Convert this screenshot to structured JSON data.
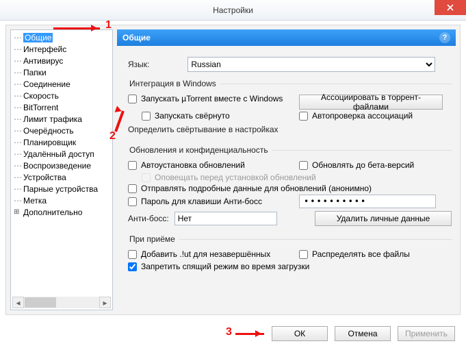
{
  "window": {
    "title": "Настройки"
  },
  "tree": {
    "items": [
      "Общие",
      "Интерфейс",
      "Антивирус",
      "Папки",
      "Соединение",
      "Скорость",
      "BitTorrent",
      "Лимит трафика",
      "Очерёдность",
      "Планировщик",
      "Удалённый доступ",
      "Воспроизведение",
      "Устройства",
      "Парные устройства",
      "Метка",
      "Дополнительно"
    ]
  },
  "panel": {
    "title": "Общие"
  },
  "language": {
    "label": "Язык:",
    "value": "Russian"
  },
  "integration": {
    "legend": "Интеграция в Windows",
    "start_with_windows": "Запускать µTorrent вместе с Windows",
    "assoc_button": "Ассоциировать в торрент-файлами",
    "start_minimized": "Запускать свёрнуто",
    "auto_check_assoc": "Автопроверка ассоциаций",
    "define_minimize": "Определить свёртывание в настройках"
  },
  "updates": {
    "legend": "Обновления и конфиденциальность",
    "auto_update": "Автоустановка обновлений",
    "beta": "Обновлять до бета-версий",
    "notify": "Оповещать перед установкой обновлений",
    "send_anon": "Отправлять подробные данные для обновлений (анонимно)",
    "boss_pw_label": "Пароль для клавиши Анти-босс",
    "boss_pw_value": "••••••••••",
    "anti_boss_label": "Анти-босс:",
    "anti_boss_value": "Нет",
    "clear_data": "Удалить личные данные"
  },
  "receive": {
    "legend": "При приёме",
    "add_ut": "Добавить .!ut для незавершённых",
    "prealloc": "Распределять все файлы",
    "no_sleep": "Запретить спящий режим во время загрузки"
  },
  "footer": {
    "ok": "ОК",
    "cancel": "Отмена",
    "apply": "Применить"
  },
  "anno": {
    "one": "1",
    "two": "2",
    "three": "3"
  }
}
